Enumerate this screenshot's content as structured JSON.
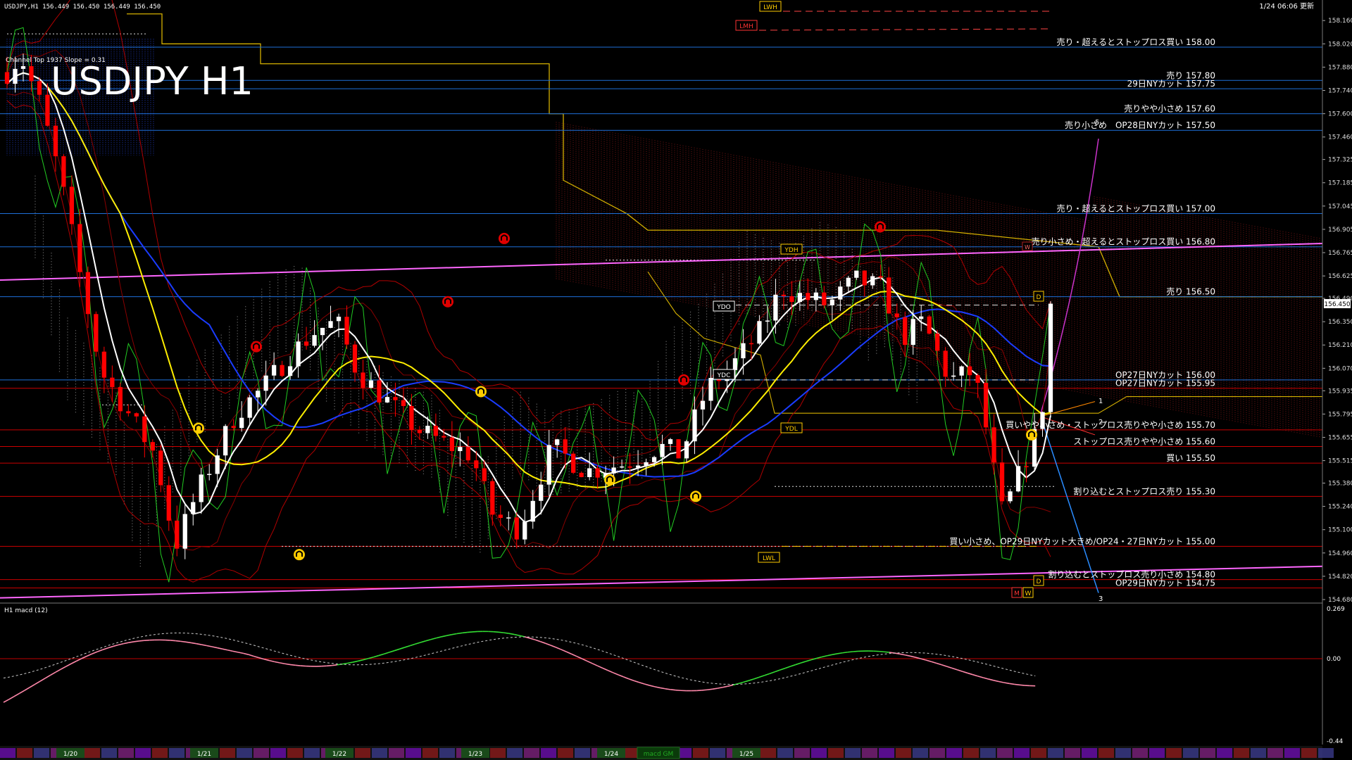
{
  "header": {
    "symbol_info": "USDJPY,H1  156.449 156.450 156.449 156.450",
    "updated": "1/24 06:06 更新",
    "big_title": "USDJPY H1",
    "channel_info": "Channel Top 1937 Slope = 0.31"
  },
  "colors": {
    "background": "#000000",
    "bull_candle": "#ffffff",
    "bear_candle": "#ff0000",
    "level_blue": "#1e6fd9",
    "level_red": "#cc0000",
    "ichimoku_cloud": "#c0c0c0",
    "kumo_red": "#b22222",
    "ma_white": "#ffffff",
    "ma_yellow": "#ffee00",
    "ma_blue": "#1a3cff",
    "channel_pink": "#ff66ff",
    "rsi_green": "#22cc22",
    "macd_green": "#33dd33",
    "macd_pink": "#ff88aa"
  },
  "markers": {
    "lwh": "LWH",
    "lmh": "LMH",
    "ydh": "YDH",
    "ydo": "YDO",
    "ydc": "YDC",
    "ydl": "YDL",
    "lwl": "LWL",
    "d_top": "D",
    "w_top": "W",
    "d_bottom": "D",
    "m_bottom": "M",
    "w_bottom": "W",
    "projection_labels": [
      "1",
      "2",
      "3",
      "5"
    ]
  },
  "price_tag": "156.450",
  "macd": {
    "label": "H1  macd (12)",
    "ticks": [
      "0.269",
      "0.00",
      "-0.44"
    ],
    "overlay_label": "macd GM"
  },
  "chart_data": {
    "type": "candlestick",
    "symbol": "USDJPY",
    "timeframe": "H1",
    "ylim": [
      154.68,
      158.22
    ],
    "price_ticks": [
      "158.160",
      "158.020",
      "157.880",
      "157.740",
      "157.600",
      "157.460",
      "157.325",
      "157.185",
      "157.045",
      "156.905",
      "156.765",
      "156.625",
      "156.490",
      "156.350",
      "156.210",
      "156.070",
      "155.935",
      "155.795",
      "155.655",
      "155.515",
      "155.380",
      "155.240",
      "155.100",
      "154.960",
      "154.820",
      "154.680"
    ],
    "date_labels": [
      "1/20",
      "1/21",
      "1/22",
      "1/23",
      "1/24",
      "1/25"
    ],
    "levels": [
      {
        "price": 158.0,
        "label": "売り・超えるとストップロス買い 158.00",
        "color": "blue"
      },
      {
        "price": 157.8,
        "label": "売り 157.80",
        "color": "blue"
      },
      {
        "price": 157.75,
        "label": "29日NYカット 157.75",
        "color": "blue"
      },
      {
        "price": 157.6,
        "label": "売りやや小さめ 157.60",
        "color": "blue"
      },
      {
        "price": 157.5,
        "label": "売り小さめ　OP28日NYカット 157.50",
        "color": "blue"
      },
      {
        "price": 157.0,
        "label": "売り・超えるとストップロス買い 157.00",
        "color": "blue"
      },
      {
        "price": 156.8,
        "label": "売り小さめ・超えるとストップロス買い 156.80",
        "color": "blue"
      },
      {
        "price": 156.5,
        "label": "売り 156.50",
        "color": "blue"
      },
      {
        "price": 156.0,
        "label": "OP27日NYカット 156.00",
        "color": "blue"
      },
      {
        "price": 155.95,
        "label": "OP27日NYカット 155.95",
        "color": "red"
      },
      {
        "price": 155.7,
        "label": "買いやや小さめ・ストップロス売りやや小さめ 155.70",
        "color": "red"
      },
      {
        "price": 155.6,
        "label": "ストップロス売りやや小さめ 155.60",
        "color": "red"
      },
      {
        "price": 155.5,
        "label": "買い 155.50",
        "color": "red"
      },
      {
        "price": 155.3,
        "label": "割り込むとストップロス売り 155.30",
        "color": "red"
      },
      {
        "price": 155.0,
        "label": "買い小さめ、OP29日NYカット大きめ/OP24・27日NYカット 155.00",
        "color": "red"
      },
      {
        "price": 154.8,
        "label": "割り込むとストップロス売り小さめ 154.80",
        "color": "red"
      },
      {
        "price": 154.75,
        "label": "OP29日NYカット 154.75",
        "color": "red"
      }
    ]
  }
}
